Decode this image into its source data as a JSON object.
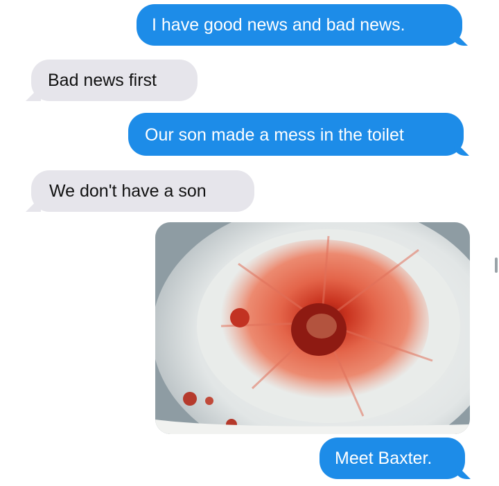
{
  "conversation": {
    "messages": [
      {
        "side": "sent",
        "text": "I have good news and bad news."
      },
      {
        "side": "received",
        "text": "Bad news first"
      },
      {
        "side": "sent",
        "text": "Our son made a mess in the toilet"
      },
      {
        "side": "received",
        "text": "We don't have a son"
      },
      {
        "side": "sent",
        "type": "image",
        "image": "toilet-bowl-photo"
      },
      {
        "side": "sent",
        "text": "Meet Baxter."
      }
    ]
  },
  "colors": {
    "sent_bubble": "#1d8ce8",
    "received_bubble": "#e6e5eb",
    "background": "#ffffff"
  }
}
